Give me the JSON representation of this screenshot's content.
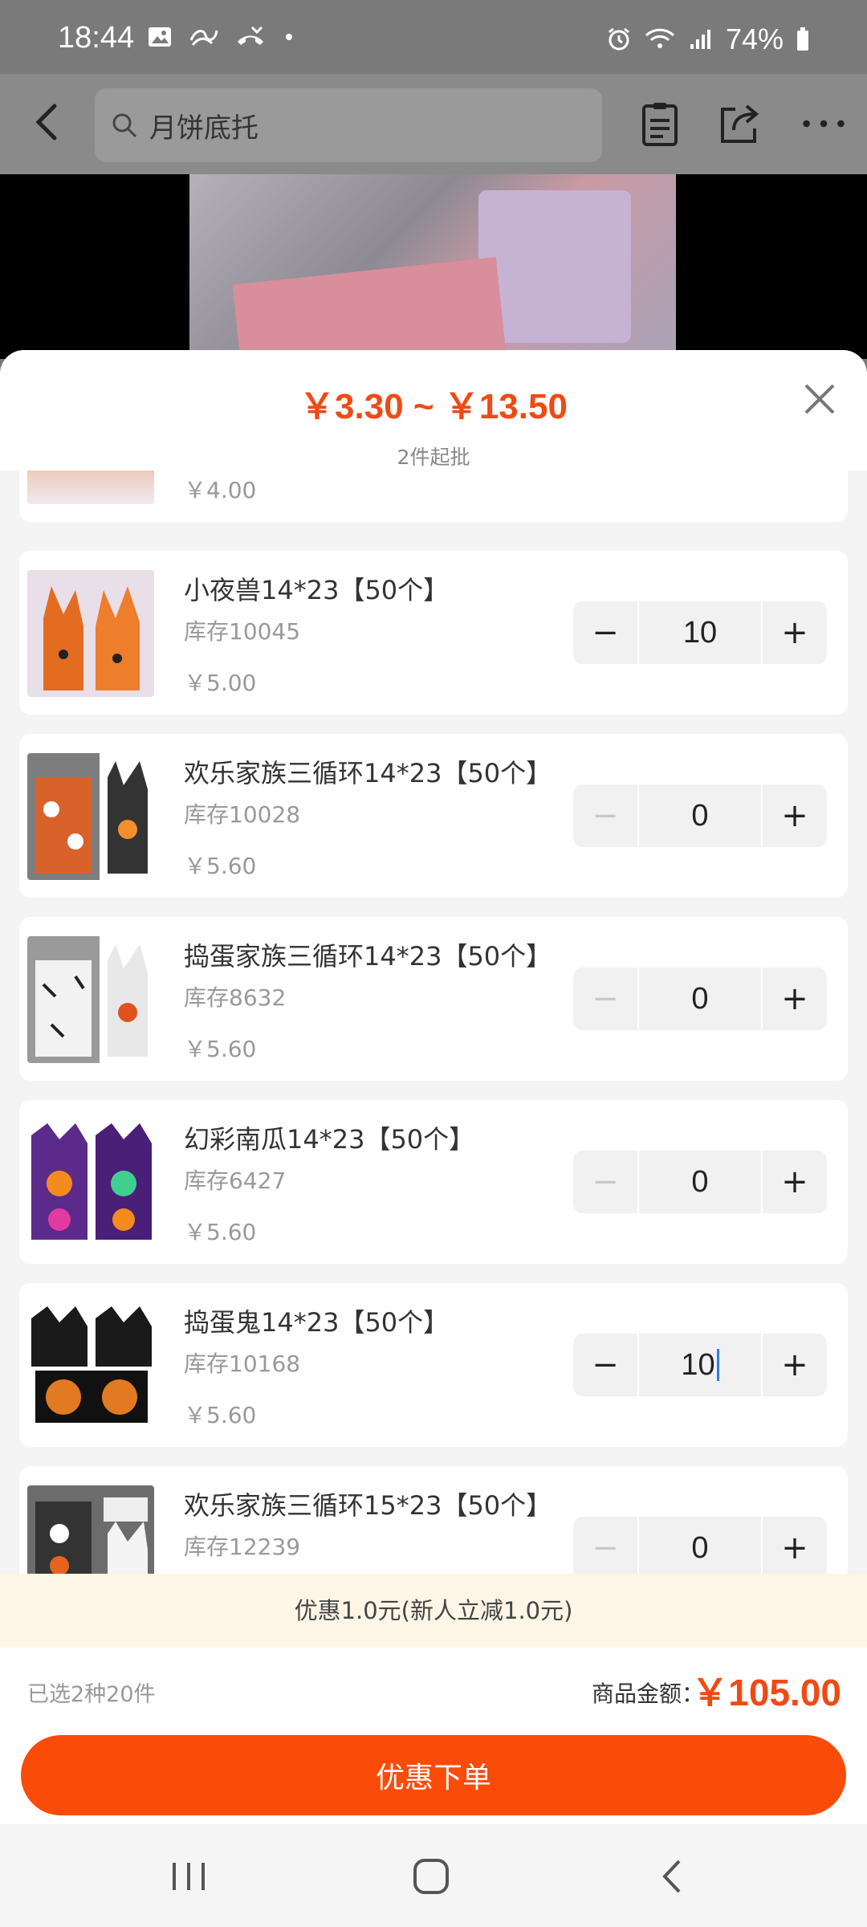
{
  "status_bar": {
    "time": "18:44",
    "battery": "74%"
  },
  "header": {
    "search_placeholder": "月饼底托"
  },
  "sheet": {
    "price_range": "￥3.30 ~ ￥13.50",
    "moq": "2件起批",
    "partial_item_price": "￥4.00",
    "items": [
      {
        "name": "小夜兽14*23【50个】",
        "stock": "库存10045",
        "price": "￥5.00",
        "qty": "10"
      },
      {
        "name": "欢乐家族三循环14*23【50个】",
        "stock": "库存10028",
        "price": "￥5.60",
        "qty": "0"
      },
      {
        "name": "捣蛋家族三循环14*23【50个】",
        "stock": "库存8632",
        "price": "￥5.60",
        "qty": "0"
      },
      {
        "name": "幻彩南瓜14*23【50个】",
        "stock": "库存6427",
        "price": "￥5.60",
        "qty": "0"
      },
      {
        "name": "捣蛋鬼14*23【50个】",
        "stock": "库存10168",
        "price": "￥5.60",
        "qty": "10"
      },
      {
        "name": "欢乐家族三循环15*23【50个】",
        "stock": "库存12239",
        "price": "",
        "qty": "0"
      }
    ],
    "stepper": {
      "minus": "−",
      "plus": "+"
    }
  },
  "footer": {
    "promo": "优惠1.0元(新人立减1.0元)",
    "selected": "已选2种20件",
    "total_label": "商品金额：",
    "total": "￥105.00",
    "order_button": "优惠下单"
  },
  "colors": {
    "accent": "#f04a14",
    "button": "#fb4b08"
  }
}
